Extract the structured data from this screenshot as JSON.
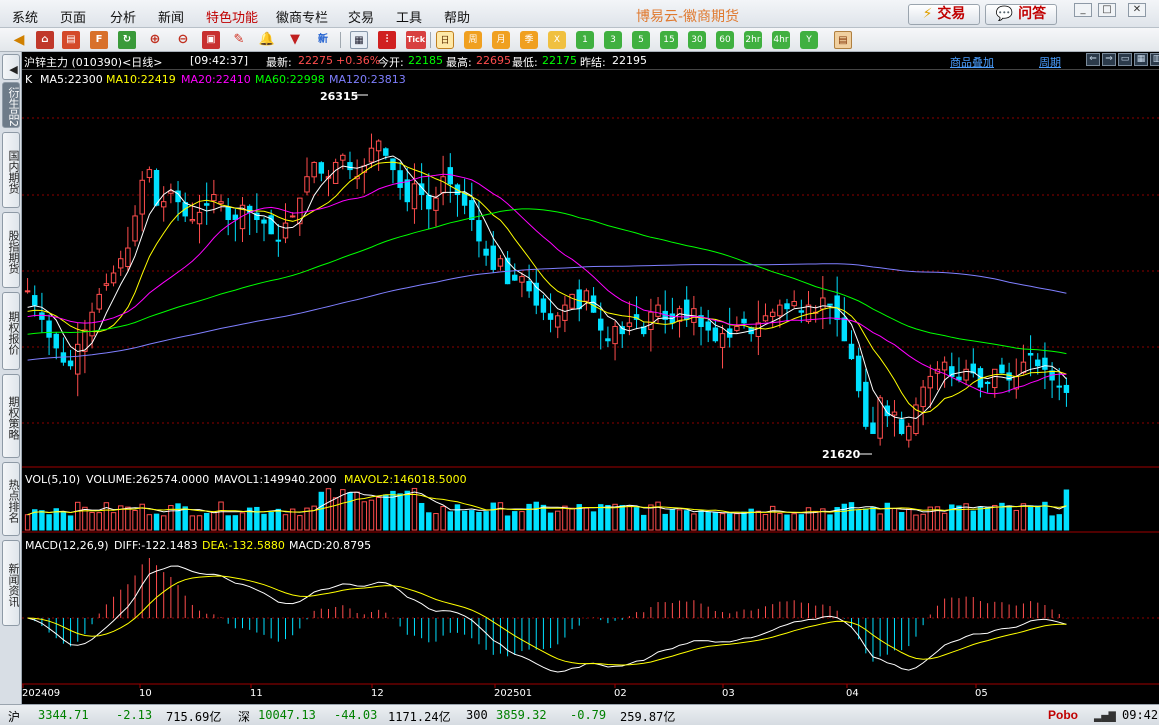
{
  "app": {
    "title": "博易云-徽商期货",
    "trade_label": "交易",
    "qa_label": "问答"
  },
  "menu": [
    "系统",
    "页面",
    "分析",
    "新闻",
    "特色功能",
    "徽商专栏",
    "交易",
    "工具",
    "帮助"
  ],
  "toolbar": {
    "periods": [
      "日",
      "周",
      "月",
      "季",
      "X",
      "1",
      "3",
      "5",
      "15",
      "30",
      "60",
      "2hr",
      "4hr",
      "Y"
    ],
    "new_label": "新",
    "tick_label": "Tick"
  },
  "left_tabs": [
    "衍生品2",
    "国内期货",
    "股指期货",
    "期权报价",
    "期权策略",
    "热点排名",
    "新闻资讯"
  ],
  "quote": {
    "name": "沪锌主力 (010390)<日线>",
    "time": "[09:42:37]",
    "latest_label": "最新:",
    "latest": "22275",
    "change_pct": "+0.36%",
    "open_label": "今开:",
    "open": "22185",
    "high_label": "最高:",
    "high": "22695",
    "low_label": "最低:",
    "low": "22175",
    "prev_label": "昨结:",
    "prev": "22195",
    "overlay_link": "商品叠加",
    "period_link": "周期"
  },
  "ma_legend": {
    "k": "K",
    "ma5": "MA5:22300",
    "ma10": "MA10:22419",
    "ma20": "MA20:22410",
    "ma60": "MA60:22998",
    "ma120": "MA120:23813"
  },
  "vol_legend": {
    "name": "VOL(5,10)",
    "volume": "VOLUME:262574.0000",
    "mavol1": "MAVOL1:149940.2000",
    "mavol2": "MAVOL2:146018.5000"
  },
  "macd_legend": {
    "name": "MACD(12,26,9)",
    "diff": "DIFF:-122.1483",
    "dea": "DEA:-132.5880",
    "macd": "MACD:20.8795"
  },
  "annotations": {
    "high_mark": "26315",
    "low_mark": "21620"
  },
  "x_axis": [
    "202409",
    "10",
    "11",
    "12",
    "202501",
    "02",
    "03",
    "04",
    "05"
  ],
  "status": {
    "sh_label": "沪",
    "sh_value": "3344.71",
    "sh_change": "-2.13",
    "sh_amount": "715.69亿",
    "sz_label": "深",
    "sz_value": "10047.13",
    "sz_change": "-44.03",
    "sz_amount": "1171.24亿",
    "i300_label": "300",
    "i300_value": "3859.32",
    "i300_change": "-0.79",
    "i300_amount": "259.87亿",
    "brand": "Pobo",
    "clock": "09:42"
  },
  "colors": {
    "up": "#ff4d4d",
    "down": "#00e0ff",
    "ma5": "#ffffff",
    "ma10": "#ffff00",
    "ma20": "#ff00ff",
    "ma60": "#00ff00",
    "ma120": "#7f7fff",
    "grid": "#8b0000"
  },
  "chart_data": {
    "type": "candlestick",
    "title": "沪锌主力 (010390)<日线>",
    "price_axis_range": [
      21620,
      26315
    ],
    "period": "daily",
    "x_range": [
      "2024-09",
      "2025-05"
    ],
    "close_series": [
      23700,
      23500,
      23300,
      23050,
      22900,
      22700,
      22650,
      22950,
      23150,
      23400,
      23650,
      23800,
      23950,
      24150,
      24300,
      24750,
      25250,
      25400,
      24900,
      24950,
      25100,
      24950,
      24750,
      24700,
      24800,
      24900,
      25050,
      24950,
      24700,
      24700,
      24900,
      24800,
      24700,
      24650,
      24500,
      24400,
      24650,
      24750,
      25000,
      25300,
      25500,
      25350,
      25300,
      25500,
      25600,
      25400,
      25300,
      25450,
      25700,
      25800,
      25600,
      25400,
      25150,
      24950,
      25200,
      25050,
      24850,
      25000,
      25300,
      25200,
      25050,
      24900,
      24700,
      24400,
      24200,
      24000,
      24150,
      23800,
      23850,
      23900,
      23700,
      23500,
      23400,
      23300,
      23350,
      23500,
      23650,
      23450,
      23700,
      23400,
      23150,
      23000,
      23200,
      23100,
      23250,
      23300,
      23100,
      23400,
      23500,
      23300,
      23250,
      23450,
      23300,
      23450,
      23200,
      23150,
      23000,
      23100,
      23050,
      23200,
      23250,
      23100,
      23250,
      23350,
      23400,
      23500,
      23450,
      23550,
      23400,
      23500,
      23400,
      23600,
      23500,
      23300,
      23000,
      22750,
      22300,
      21800,
      21700,
      22200,
      21950,
      22000,
      21700,
      21800,
      22100,
      22350,
      22500,
      22600,
      22700,
      22500,
      22450,
      22600,
      22550,
      22350,
      22400,
      22600,
      22550,
      22450,
      22500,
      22700,
      22800,
      22650,
      22600,
      22450,
      22350,
      22275
    ]
  }
}
